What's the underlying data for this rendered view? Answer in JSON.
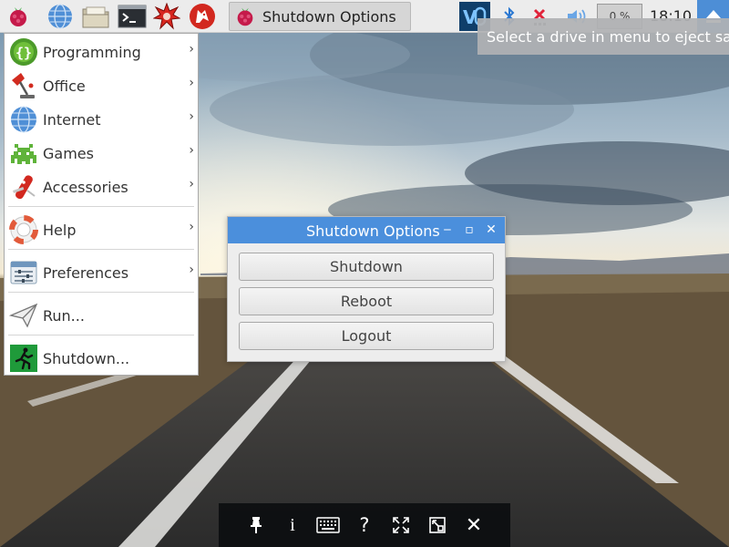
{
  "taskbar": {
    "icons": [
      "raspberry-menu-icon",
      "web-browser-icon",
      "file-manager-icon",
      "terminal-icon",
      "mathematica-icon",
      "wolfram-icon"
    ],
    "active_task": {
      "label": "Shutdown Options",
      "icon": "raspberry-icon"
    },
    "tray": {
      "vnc_icon": "vnc-icon",
      "bluetooth_icon": "bluetooth-icon",
      "network_icon": "network-disconnected-icon",
      "volume_icon": "volume-icon",
      "cpu_text": "0 %",
      "clock": "18:10",
      "eject_icon": "eject-icon"
    }
  },
  "tooltip": {
    "text": "Select a drive in menu to eject safely"
  },
  "app_menu": {
    "items": [
      {
        "label": "Programming",
        "icon": "programming-icon",
        "submenu": true
      },
      {
        "label": "Office",
        "icon": "office-icon",
        "submenu": true
      },
      {
        "label": "Internet",
        "icon": "internet-icon",
        "submenu": true
      },
      {
        "label": "Games",
        "icon": "games-icon",
        "submenu": true
      },
      {
        "label": "Accessories",
        "icon": "accessories-icon",
        "submenu": true
      },
      {
        "label": "Help",
        "icon": "help-icon",
        "submenu": true
      },
      {
        "label": "Preferences",
        "icon": "preferences-icon",
        "submenu": true
      },
      {
        "label": "Run...",
        "icon": "run-icon",
        "submenu": false
      },
      {
        "label": "Shutdown...",
        "icon": "shutdown-icon",
        "submenu": false
      }
    ],
    "arrow": "›"
  },
  "dialog": {
    "title": "Shutdown Options",
    "minimize": "‒",
    "maximize": "▫",
    "close": "✕",
    "buttons": [
      "Shutdown",
      "Reboot",
      "Logout"
    ]
  },
  "osk_toolbar": {
    "icons": [
      "pin-icon",
      "info-icon",
      "keyboard-icon",
      "help-icon",
      "fullscreen-icon",
      "scale-icon",
      "close-icon"
    ],
    "info_glyph": "i",
    "help_glyph": "?",
    "close_glyph": "✕"
  },
  "colors": {
    "titlebar": "#4b8fdc",
    "taskbar": "#ececec",
    "tray_accent": "#4d8ed6"
  }
}
